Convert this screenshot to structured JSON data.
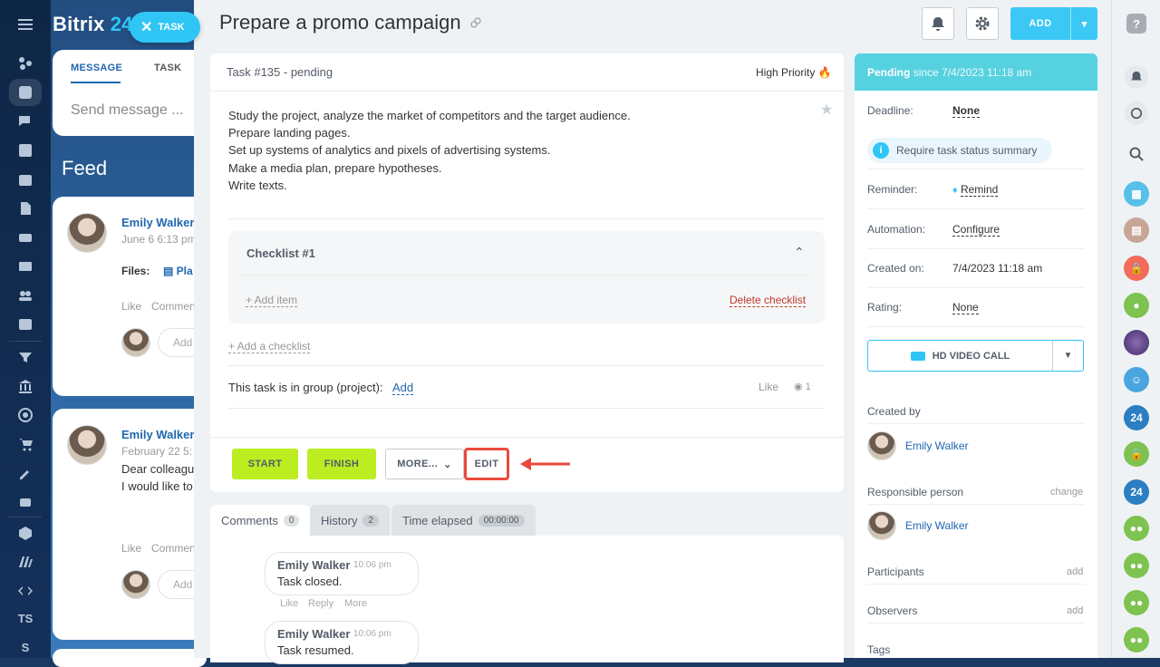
{
  "brand": {
    "name": "Bitrix",
    "suffix": "24"
  },
  "task_button": {
    "label": "TASK"
  },
  "composer": {
    "tabs": [
      "MESSAGE",
      "TASK"
    ],
    "placeholder": "Send message ..."
  },
  "feed": {
    "title": "Feed",
    "posts": [
      {
        "author": "Emily Walker",
        "date": "June 6 6:13 pm",
        "files_label": "Files:",
        "file": "Pla",
        "actions": [
          "Like",
          "Commen"
        ],
        "comment_placeholder": "Add"
      },
      {
        "author": "Emily Walker",
        "date": "February 22 5:",
        "text": [
          "Dear colleagu",
          "I would like to"
        ],
        "actions": [
          "Like",
          "Commen"
        ],
        "comment_placeholder": "Add"
      }
    ]
  },
  "sidebar": {
    "labels": [
      "TS",
      "S"
    ]
  },
  "task": {
    "title": "Prepare a promo campaign",
    "status_line": "Task #135 - pending",
    "priority": "High Priority",
    "description": [
      "Study the project, analyze the market of competitors and the target audience.",
      "Prepare landing pages.",
      "Set up systems of analytics and pixels of advertising systems.",
      "Make a media plan, prepare hypotheses.",
      "Write texts."
    ],
    "checklist": {
      "title": "Checklist #1",
      "add_item": "+ Add item",
      "delete": "Delete checklist"
    },
    "add_checklist": "+ Add a checklist",
    "group_label": "This task is in group (project):",
    "group_add": "Add",
    "like": "Like",
    "views": "1",
    "buttons": {
      "start": "START",
      "finish": "FINISH",
      "more": "MORE...",
      "edit": "EDIT"
    }
  },
  "header": {
    "add_label": "ADD"
  },
  "comments": {
    "tabs": [
      {
        "label": "Comments",
        "count": "0"
      },
      {
        "label": "History",
        "count": "2"
      },
      {
        "label": "Time elapsed",
        "count": "00:00:00"
      }
    ],
    "items": [
      {
        "author": "Emily Walker",
        "time": "10:06 pm",
        "text": "Task closed.",
        "actions": [
          "Like",
          "Reply",
          "More"
        ]
      },
      {
        "author": "Emily Walker",
        "time": "10:06 pm",
        "text": "Task resumed."
      }
    ]
  },
  "info": {
    "status": "Pending",
    "since": "since 7/4/2023 11:18 am",
    "deadline_label": "Deadline:",
    "deadline": "None",
    "summary": "Require task status summary",
    "reminder_label": "Reminder:",
    "reminder": "Remind",
    "automation_label": "Automation:",
    "automation": "Configure",
    "created_on_label": "Created on:",
    "created_on": "7/4/2023 11:18 am",
    "rating_label": "Rating:",
    "rating": "None",
    "video_call": "HD VIDEO CALL",
    "created_by_label": "Created by",
    "created_by": "Emily Walker",
    "responsible_label": "Responsible person",
    "responsible_change": "change",
    "responsible": "Emily Walker",
    "participants_label": "Participants",
    "participants_add": "add",
    "observers_label": "Observers",
    "observers_add": "add",
    "tags_label": "Tags"
  },
  "rail": {
    "badges": [
      "24",
      "24"
    ]
  },
  "colors": {
    "accent": "#3bc8f5",
    "green": "#bbed21",
    "status": "#56d1e0",
    "highlight": "#e84a3c"
  }
}
